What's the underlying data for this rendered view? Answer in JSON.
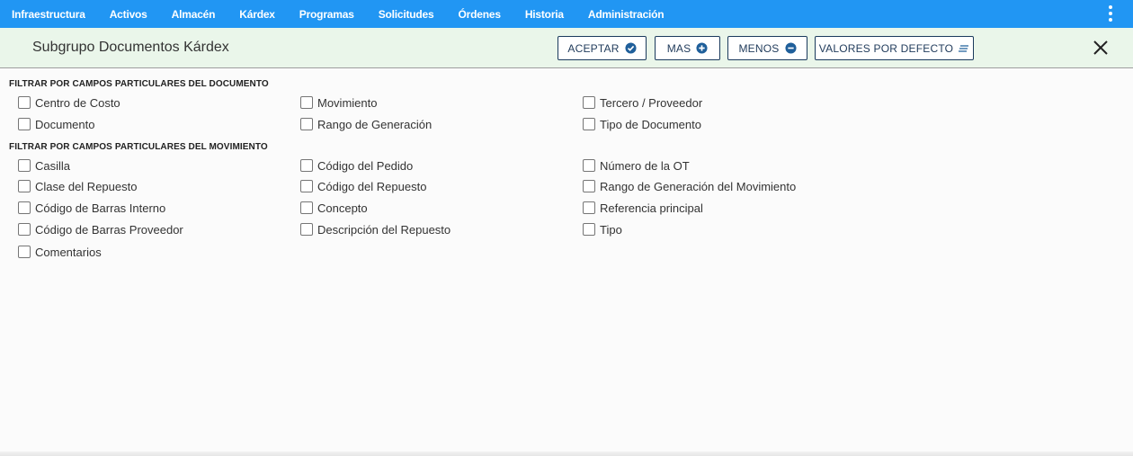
{
  "nav": {
    "items": [
      "Infraestructura",
      "Activos",
      "Almacén",
      "Kárdex",
      "Programas",
      "Solicitudes",
      "Órdenes",
      "Historia",
      "Administración"
    ],
    "more_icon": "vertical-dots-icon"
  },
  "header": {
    "title": "Subgrupo Documentos Kárdex",
    "buttons": {
      "aceptar": "ACEPTAR",
      "mas": "MAS",
      "menos": "MENOS",
      "defecto": "VALORES POR DEFECTO"
    },
    "icons": {
      "aceptar": "check-circle-icon",
      "mas": "plus-circle-icon",
      "menos": "minus-circle-icon",
      "defecto": "list-lines-icon",
      "close": "close-icon"
    },
    "colors": {
      "nav_bg": "#2196f3",
      "title_bg": "#eaf6ea",
      "button_text": "#1f3a5a"
    }
  },
  "documento": {
    "title": "FILTRAR POR CAMPOS PARTICULARES DEL DOCUMENTO",
    "fields": [
      "Centro de Costo",
      "Movimiento",
      "Tercero / Proveedor",
      "Documento",
      "Rango de Generación",
      "Tipo de Documento"
    ]
  },
  "movimiento": {
    "title": "FILTRAR POR CAMPOS PARTICULARES DEL MOVIMIENTO",
    "fields": [
      "Casilla",
      "Código del Pedido",
      "Número de la OT",
      "Clase del Repuesto",
      "Código del Repuesto",
      "Rango de Generación del Movimiento",
      "Código de Barras Interno",
      "Concepto",
      "Referencia principal",
      "Código de Barras Proveedor",
      "Descripción del Repuesto",
      "Tipo",
      "Comentarios"
    ]
  },
  "checked": false
}
